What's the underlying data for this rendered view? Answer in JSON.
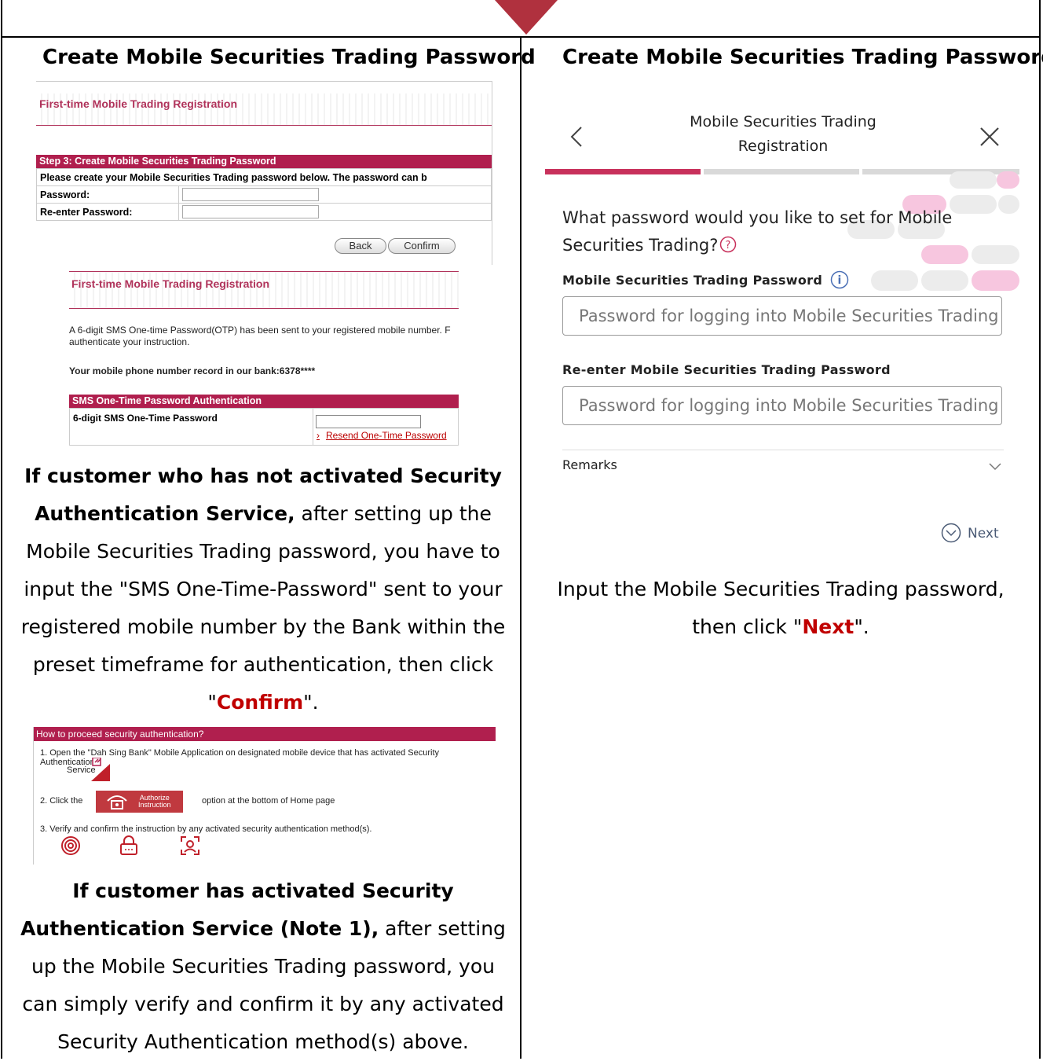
{
  "left_column": {
    "title": "Create Mobile Securities Trading Password",
    "shot1": {
      "header": "First-time Mobile Trading Registration",
      "step_title": "Step 3: Create Mobile Securities Trading Password",
      "instruction": "Please create your Mobile Securities Trading password below. The password can b",
      "password_label": "Password:",
      "reenter_label": "Re-enter Password:",
      "back_button": "Back",
      "confirm_button": "Confirm"
    },
    "shot2": {
      "header": "First-time Mobile Trading Registration",
      "message_line1": "A 6-digit SMS One-time Password(OTP) has been sent to your registered mobile number. F",
      "message_line2": "authenticate your instruction.",
      "record": "Your mobile phone number record in our bank:6378****",
      "otp_header": "SMS One-Time Password Authentication",
      "otp_label": "6-digit SMS One-Time Password",
      "resend_link": "Resend One-Time Password"
    },
    "para1": {
      "bold": "If customer who has not activated Security Authentication Service,",
      "text": " after setting up the Mobile Securities Trading password, you have to input the \"SMS One-Time-Password\" sent to your registered mobile number by the Bank within the preset timeframe for authentication, then click \"",
      "highlight": "Confirm",
      "end": "\"."
    },
    "shot3": {
      "header": "How to proceed security authentication?",
      "step1": "1.   Open the \"Dah Sing Bank\" Mobile Application on designated mobile device that has activated Security Authentication",
      "step1b": "Service",
      "step2_pre": "2.   Click the",
      "auth_btn_line1": "Authorize",
      "auth_btn_line2": "Instruction",
      "step2_post": "option at the bottom of Home page",
      "step3": "3.   Verify and confirm the instruction by any activated security authentication method(s)."
    },
    "para2": {
      "bold": "If customer has activated Security Authentication Service (Note 1),",
      "text": " after setting up the Mobile Securities Trading password, you can simply verify and confirm it by any activated Security Authentication method(s) above."
    }
  },
  "right_column": {
    "title": "Create Mobile Securities Trading Password",
    "mobile": {
      "nav_title": "Mobile Securities Trading Registration",
      "question": "What password would you like to set for Mobile Securities Trading?",
      "password_label": "Mobile Securities Trading Password",
      "password_placeholder": "Password for logging into Mobile Securities Trading",
      "reenter_label": "Re-enter Mobile Securities Trading Password",
      "reenter_placeholder": "Password for logging into Mobile Securities Trading",
      "remarks": "Remarks",
      "next": "Next",
      "progress_step": 1,
      "progress_total": 3
    },
    "para": {
      "text": "Input the Mobile Securities Trading password, then click \"",
      "highlight": "Next",
      "end": "\"."
    }
  },
  "colors": {
    "brand_red": "#b01f4e",
    "highlight_red": "#c00000",
    "arrow": "#b0313e"
  }
}
